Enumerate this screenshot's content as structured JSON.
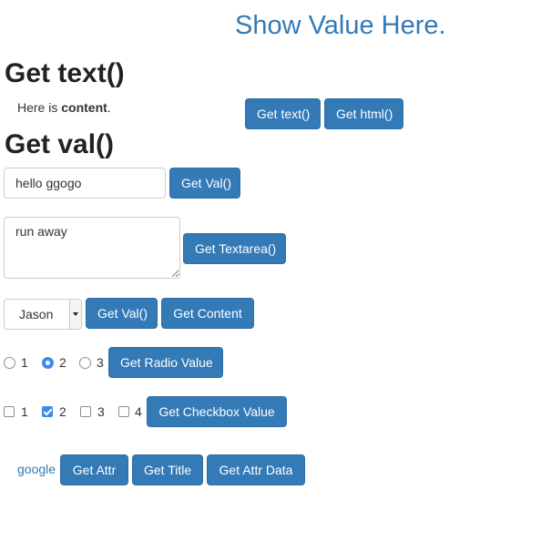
{
  "show_value": "Show Value Here.",
  "get_text_section": {
    "heading": "Get text()",
    "content_prefix": "Here is ",
    "content_bold": "content",
    "content_suffix": ".",
    "get_text_button": "Get text()",
    "get_html_button": "Get html()"
  },
  "get_val_section": {
    "heading": "Get val()",
    "input_value": "hello ggogo",
    "get_val_button": "Get Val()",
    "textarea_value": "run away",
    "get_textarea_button": "Get Textarea()",
    "select_value": "Jason",
    "select_get_val_button": "Get Val()",
    "select_get_content_button": "Get Content",
    "radio_options": [
      "1",
      "2",
      "3"
    ],
    "radio_selected": "2",
    "get_radio_button": "Get Radio Value",
    "checkbox_options": [
      "1",
      "2",
      "3",
      "4"
    ],
    "checkbox_checked": [
      "2"
    ],
    "get_checkbox_button": "Get Checkbox Value"
  },
  "attr_section": {
    "link_text": "google",
    "get_attr_button": "Get Attr",
    "get_title_button": "Get Title",
    "get_attr_data_button": "Get Attr Data"
  },
  "colors": {
    "primary": "#337ab7",
    "primary_border": "#2e6da4",
    "checked": "#3b8beb"
  }
}
